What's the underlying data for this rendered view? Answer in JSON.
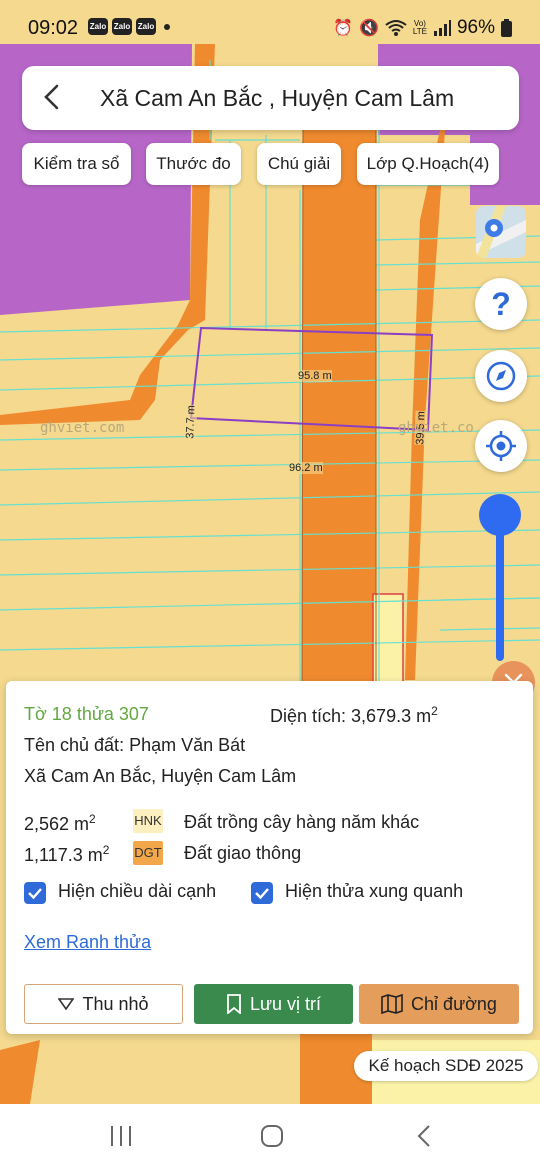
{
  "status_bar": {
    "time": "09:02",
    "zalo_label": "Zalo",
    "battery": "96%"
  },
  "header": {
    "title": "Xã Cam An Bắc , Huyện Cam Lâm"
  },
  "toolbar": {
    "chips": [
      "Kiểm tra sổ",
      "Thước đo",
      "Chú giải",
      "Lớp Q.Hoạch(4)"
    ]
  },
  "map": {
    "watermark": "ghviet.com",
    "watermark_right": "ghviet.co",
    "edge_top": "95.8 m",
    "edge_bottom": "96.2 m",
    "edge_left": "37.7 m",
    "edge_right": "39.5 m",
    "colors": {
      "residential": "#f4d98e",
      "road": "#ef8a2e",
      "purple_zone": "#b766c8",
      "boundary": "#8b3fc4",
      "lines": "#66e0d0"
    }
  },
  "side_controls": {
    "icons": [
      "map-layer-icon",
      "help-icon",
      "compass-icon",
      "locate-icon"
    ],
    "help_glyph": "?"
  },
  "parcel": {
    "title": "Tờ 18 thửa 307",
    "area_label": "Diện tích: 3,679.3 m",
    "area_sup": "2",
    "owner": "Tên chủ đất: Phạm Văn Bát",
    "address": "Xã Cam An Bắc, Huyện Cam Lâm",
    "land_uses": [
      {
        "area": "2,562 m",
        "sup": "2",
        "code": "HNK",
        "desc": "Đất trồng cây hàng năm khác",
        "color": "#fdf0c0"
      },
      {
        "area": "1,117.3 m",
        "sup": "2",
        "code": "DGT",
        "desc": "Đất giao thông",
        "color": "#f2a74a"
      }
    ],
    "checkboxes": [
      {
        "label": "Hiện chiều dài cạnh",
        "checked": true
      },
      {
        "label": "Hiện thửa xung quanh",
        "checked": true
      }
    ],
    "link": "Xem Ranh thửa",
    "buttons": {
      "shrink": "Thu nhỏ",
      "save": "Lưu vị trí",
      "directions": "Chỉ đường"
    }
  },
  "plan_label": "Kế hoạch SDĐ 2025"
}
